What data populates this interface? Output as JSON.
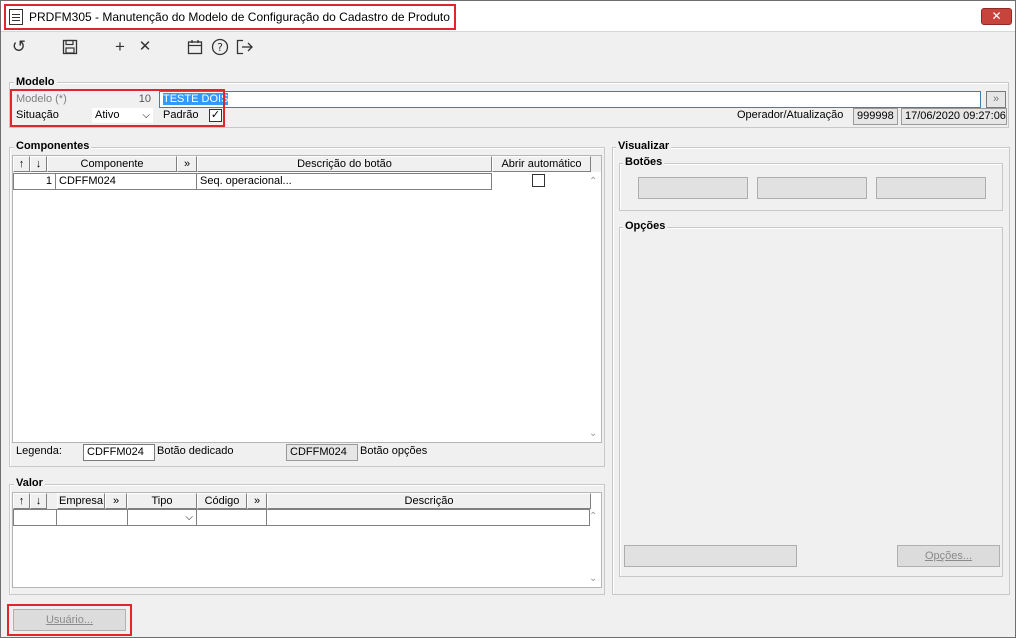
{
  "window": {
    "title": "PRDFM305 - Manutenção do Modelo de Configuração do Cadastro de Produto",
    "close_symbol": "✕"
  },
  "toolbar": {
    "icons": [
      "undo-icon",
      "save-icon",
      "add-icon",
      "cancel-icon",
      "calendar-icon",
      "help-icon",
      "exit-icon"
    ],
    "glyphs": {
      "undo": "↺",
      "save": "🖫",
      "add": "+",
      "cancel": "✕",
      "calendar": "📅",
      "help": "?",
      "exit": "⇥"
    }
  },
  "modelo": {
    "group_label": "Modelo",
    "modelo_label": "Modelo (*)",
    "modelo_value": "10",
    "descricao_value": "TESTE DOIS",
    "lookup_symbol": "»",
    "situacao_label": "Situação",
    "situacao_value": "Ativo",
    "padrao_label": "Padrão",
    "padrao_checked": "✓",
    "operador_label": "Operador/Atualização",
    "operador_value": "999998",
    "atualizacao_value": "17/06/2020 09:27:06"
  },
  "componentes": {
    "group_label": "Componentes",
    "headers": {
      "up": "↑",
      "down": "↓",
      "componente": "Componente",
      "more": "»",
      "descricao": "Descrição do botão",
      "abrir": "Abrir automático"
    },
    "rows": [
      {
        "num": "1",
        "componente": "CDFFM024",
        "descricao": "Seq. operacional..."
      }
    ],
    "legenda_label": "Legenda:",
    "legenda_dedicado_value": "CDFFM024",
    "legenda_dedicado_label": "Botão dedicado",
    "legenda_opcoes_value": "CDFFM024",
    "legenda_opcoes_label": "Botão opções"
  },
  "valor": {
    "group_label": "Valor",
    "headers": {
      "up": "↑",
      "down": "↓",
      "empresa": "Empresa",
      "more1": "»",
      "tipo": "Tipo",
      "codigo": "Código",
      "more2": "»",
      "descricao": "Descrição"
    }
  },
  "visualizar": {
    "group_label": "Visualizar",
    "botoes_label": "Botões",
    "opcoes_label": "Opções",
    "opcoes_button": "Opções..."
  },
  "footer": {
    "usuario_button": "Usuário..."
  }
}
